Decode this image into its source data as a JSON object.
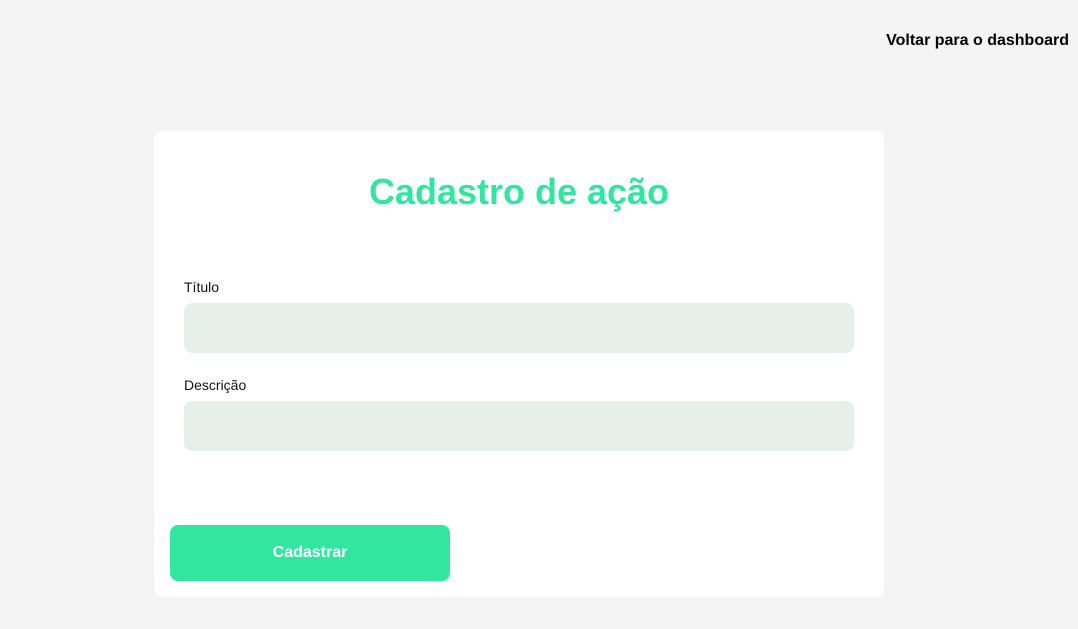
{
  "header": {
    "back_link": "Voltar para o dashboard"
  },
  "form": {
    "title": "Cadastro de ação",
    "fields": [
      {
        "label": "Título",
        "value": "",
        "placeholder": ""
      },
      {
        "label": "Descrição",
        "value": "",
        "placeholder": ""
      }
    ],
    "submit_label": "Cadastrar"
  },
  "colors": {
    "accent": "#33e6a0",
    "background": "#f4f4f4",
    "card": "#ffffff",
    "input_background": "#e7efeb"
  }
}
